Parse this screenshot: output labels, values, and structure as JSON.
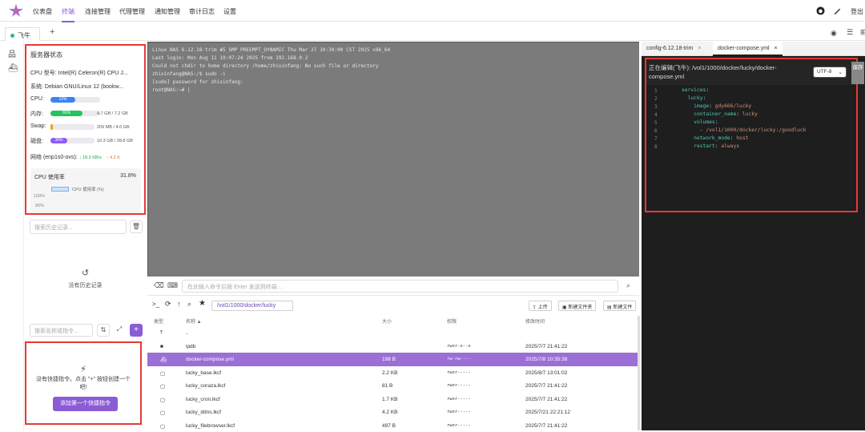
{
  "nav": {
    "items": [
      "仪表盘",
      "终端",
      "连接管理",
      "代理管理",
      "通知管理",
      "审计日志",
      "设置"
    ],
    "active": "终端",
    "logout": "登出"
  },
  "session_tabs": {
    "active_tab": "飞牛",
    "add": "+"
  },
  "status": {
    "title": "服务器状态",
    "cpu_model_label": "CPU 型号:",
    "cpu_model": "Intel(R) Celeron(R) CPU J...",
    "system_label": "系统:",
    "system": "Debian GNU/Linux 12 (bookw...",
    "cpu_label": "CPU:",
    "cpu_pct": "12%",
    "cpu_fraction": 0.12,
    "mem_label": "内存:",
    "mem_pct": "65%",
    "mem_fraction": 0.65,
    "mem_value": "4.7 GB / 7.2 GB",
    "swap_label": "Swap:",
    "swap_pct": "5%",
    "swap_fraction": 0.05,
    "swap_value": "209 MB / 4.0 GB",
    "disk_label": "磁盘:",
    "disk_pct": "38%",
    "disk_fraction": 0.38,
    "disk_value": "10.3 GB / 28.8 GB",
    "net_label": "网络 (enp1s0-ovs):",
    "net_down": "↓ 18.3 KB/s",
    "net_up": "↑ 4.2 K",
    "cpu_usage_title": "CPU 使用率",
    "cpu_usage_pct": "31.8%",
    "legend": "CPU 使用率 (%)",
    "y100": "100%",
    "y80": "80%"
  },
  "history": {
    "search_placeholder": "搜索历史记录...",
    "empty": "没有历史记录"
  },
  "commands": {
    "search_placeholder": "搜索名称或指令...",
    "empty_text": "没有快捷指令。点击 \"+\" 按钮创建一个吧!",
    "add_first": "添加第一个快捷指令"
  },
  "terminal": {
    "lines": [
      "Linux NAS 6.12.18-trim #5 SMP PREEMPT_DYNAMIC Thu Mar 27 10:30:00 CST 2025 x86_64",
      "Last login: Mon Aug 11 19:07:24 2025 from 192.168.0.2",
      "Could not chdir to home directory /home/zhixinfang: No such file or directory",
      "zhixinfang@NAS:/$ sudo -i",
      "[sudo] password for zhixinfang:",
      "root@NAS:~# |"
    ]
  },
  "cmdbar": {
    "placeholder": "在此输入命令后按 Enter 发送到终端..."
  },
  "files": {
    "path": "/vol1/1000/docker/lucky",
    "upload": "上传",
    "new_folder": "新建文件夹",
    "new_file": "新建文件",
    "headers": {
      "type": "类型",
      "name": "名称 ▲",
      "size": "大小",
      "perm": "权限",
      "mtime": "修改时间"
    },
    "rows": [
      {
        "icon": "up-arrow",
        "name": "..",
        "size": "",
        "perm": "",
        "mtime": ""
      },
      {
        "icon": "folder",
        "name": "ipdb",
        "size": "",
        "perm": "rwxr-x--x",
        "mtime": "2025/7/7 21:41:22"
      },
      {
        "icon": "docker",
        "name": "docker-compose.yml",
        "size": "198 B",
        "perm": "rw-rw----",
        "mtime": "2025/7/8 10:35:38"
      },
      {
        "icon": "file",
        "name": "lucky_base.lkcf",
        "size": "2.2 KB",
        "perm": "rwxr-----",
        "mtime": "2025/8/7 13:01:02"
      },
      {
        "icon": "file",
        "name": "lucky_coraza.lkcf",
        "size": "81 B",
        "perm": "rwxr-----",
        "mtime": "2025/7/7 21:41:22"
      },
      {
        "icon": "file",
        "name": "lucky_cron.lkcf",
        "size": "1.7 KB",
        "perm": "rwxr-----",
        "mtime": "2025/7/7 21:41:22"
      },
      {
        "icon": "file",
        "name": "lucky_ddns.lkcf",
        "size": "4.2 KB",
        "perm": "rwxr-----",
        "mtime": "2025/7/21 22:21:12"
      },
      {
        "icon": "file",
        "name": "lucky_filebrowser.lkcf",
        "size": "497 B",
        "perm": "rwxr-----",
        "mtime": "2025/7/7 21:41:22"
      }
    ]
  },
  "editor": {
    "tabs": [
      {
        "label": "config-6.12.18-trim",
        "close": "×"
      },
      {
        "label": "docker-compose.yml",
        "close": "×"
      }
    ],
    "editing": "正在编辑(飞牛): /vol1/1000/docker/lucky/docker-compose.yml",
    "encoding": "UTF-8",
    "save": "保存",
    "code": [
      "services:",
      "  lucky:",
      "    image: gdy666/lucky",
      "    container_name: lucky",
      "    volumes:",
      "      - /vol1/1000/docker/lucky:/goodluck",
      "    network_mode: host",
      "    restart: always"
    ]
  },
  "colors": {
    "accent": "#8a5cd6",
    "highlight_border": "#e53935",
    "cpu_bar": "#3b82f6",
    "mem_bar": "#22c55e",
    "swap_bar": "#f59e0b",
    "disk_bar": "#8b5cf6"
  }
}
